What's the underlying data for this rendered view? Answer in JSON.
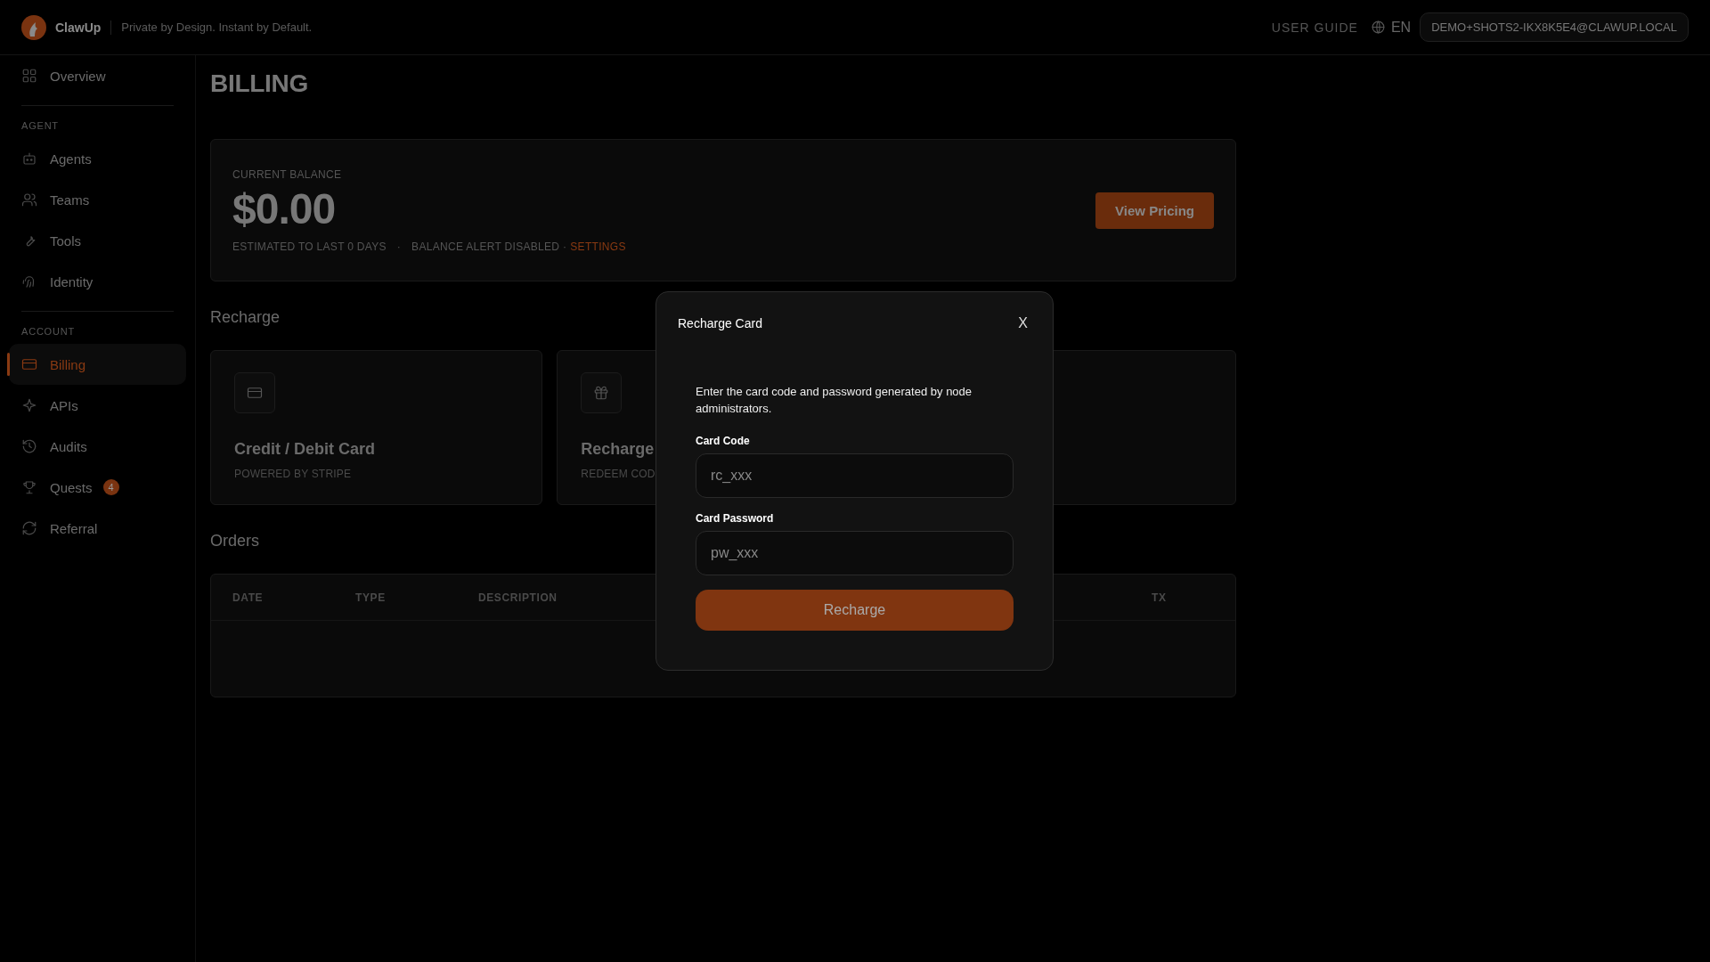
{
  "header": {
    "brand": "ClawUp",
    "tagline": "Private by Design. Instant by Default.",
    "user_guide": "USER GUIDE",
    "language": "EN",
    "account": "DEMO+SHOTS2-IKX8K5E4@CLAWUP.LOCAL"
  },
  "sidebar": {
    "sections": [
      {
        "items": [
          {
            "label": "Overview",
            "selected": false
          }
        ]
      },
      {
        "title": "AGENT",
        "items": [
          {
            "label": "Agents",
            "selected": false
          },
          {
            "label": "Teams",
            "selected": false
          },
          {
            "label": "Tools",
            "selected": false
          },
          {
            "label": "Identity",
            "selected": false
          }
        ]
      },
      {
        "title": "ACCOUNT",
        "items": [
          {
            "label": "Billing",
            "selected": true
          },
          {
            "label": "APIs",
            "selected": false
          },
          {
            "label": "Audits",
            "selected": false
          },
          {
            "label": "Quests",
            "selected": false,
            "badge": "4"
          },
          {
            "label": "Referral",
            "selected": false
          }
        ]
      }
    ]
  },
  "page": {
    "title": "BILLING",
    "balance": {
      "label": "CURRENT BALANCE",
      "amount": "$0.00",
      "estimate": "ESTIMATED TO LAST 0 DAYS",
      "separator": "·",
      "alert": "BALANCE ALERT DISABLED ·",
      "settings_link": "SETTINGS",
      "button": "View Pricing"
    },
    "recharge": {
      "heading": "Recharge",
      "cards": [
        {
          "title": "Credit / Debit Card",
          "subtitle": "POWERED BY STRIPE"
        },
        {
          "title": "Recharge",
          "subtitle": "REDEEM COD"
        }
      ]
    },
    "orders": {
      "heading": "Orders",
      "columns": [
        "DATE",
        "TYPE",
        "DESCRIPTION",
        "TX"
      ]
    }
  },
  "modal": {
    "title": "Recharge Card",
    "close": "X",
    "description": "Enter the card code and password generated by node administrators.",
    "fields": [
      {
        "label": "Card Code",
        "placeholder": "rc_xxx"
      },
      {
        "label": "Card Password",
        "placeholder": "pw_xxx"
      }
    ],
    "button": "Recharge"
  }
}
